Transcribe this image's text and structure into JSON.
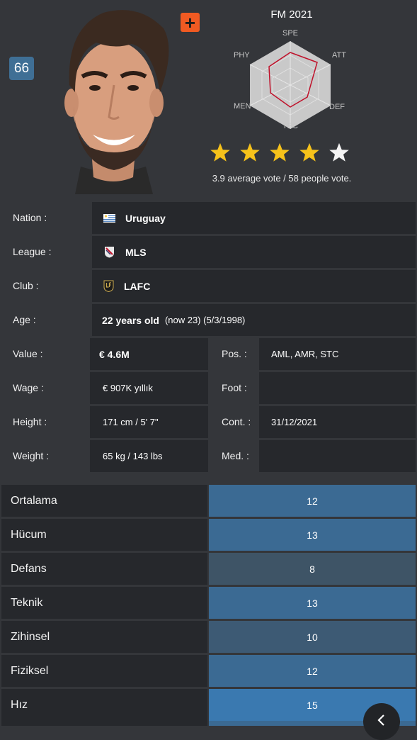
{
  "player": {
    "rating": "66",
    "add_icon": "plus-icon"
  },
  "fm": {
    "title": "FM 2021",
    "radar_labels": {
      "spe": "SPE",
      "att": "ATT",
      "def": "DEF",
      "tec": "TEC",
      "men": "MEN",
      "phy": "PHY"
    },
    "stars_filled": 4,
    "stars_total": 5,
    "vote_text": "3.9 average vote / 58 people vote."
  },
  "info": {
    "nation_label": "Nation :",
    "nation_value": "Uruguay",
    "league_label": "League :",
    "league_value": "MLS",
    "club_label": "Club :",
    "club_value": "LAFC",
    "age_label": "Age :",
    "age_value": "22 years old",
    "age_extra": "(now 23) (5/3/1998)",
    "value_label": "Value :",
    "value_value": "€ 4.6M",
    "pos_label": "Pos. :",
    "pos_value": "AML, AMR, STC",
    "wage_label": "Wage :",
    "wage_value": "€ 907K yıllık",
    "foot_label": "Foot :",
    "foot_value": "",
    "height_label": "Height :",
    "height_value": "171 cm / 5' 7\"",
    "cont_label": "Cont. :",
    "cont_value": "31/12/2021",
    "weight_label": "Weight :",
    "weight_value": "65 kg / 143 lbs",
    "med_label": "Med. :",
    "med_value": ""
  },
  "stats": [
    {
      "label": "Ortalama",
      "value": "12",
      "color": "#3b6a93"
    },
    {
      "label": "Hücum",
      "value": "13",
      "color": "#3b6a93"
    },
    {
      "label": "Defans",
      "value": "8",
      "color": "#3e5466"
    },
    {
      "label": "Teknik",
      "value": "13",
      "color": "#3b6a93"
    },
    {
      "label": "Zihinsel",
      "value": "10",
      "color": "#3d5a74"
    },
    {
      "label": "Fiziksel",
      "value": "12",
      "color": "#3b6a93"
    },
    {
      "label": "Hız",
      "value": "15",
      "color": "#3a79b0"
    }
  ],
  "fab_icon": "chevron-left-icon"
}
